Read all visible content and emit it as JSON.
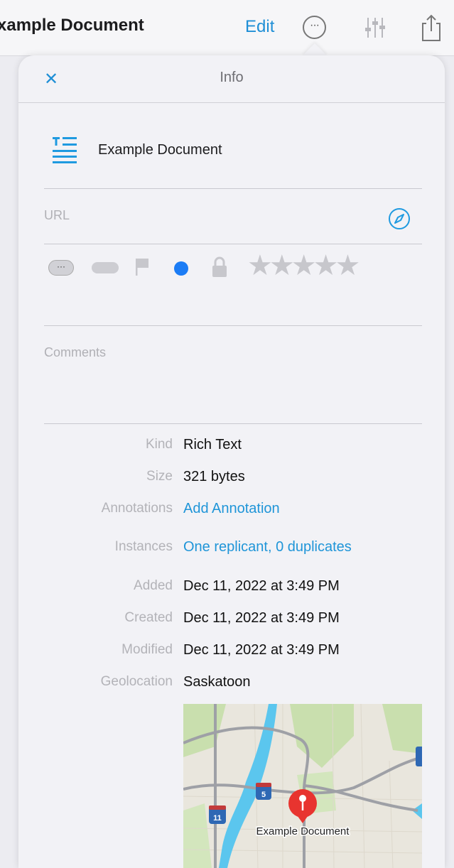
{
  "toolbar": {
    "title": "xample Document",
    "edit_label": "Edit",
    "more_label": "···"
  },
  "info": {
    "title": "Info",
    "close_label": "✕",
    "doc_name": "Example Document",
    "url_label": "URL",
    "tag_label": "···",
    "stars": "★★★★★",
    "rating": 0,
    "label_color": "#1b7cf5",
    "comments_placeholder": "Comments"
  },
  "meta": {
    "kind": {
      "label": "Kind",
      "value": "Rich Text"
    },
    "size": {
      "label": "Size",
      "value": "321 bytes"
    },
    "annotations": {
      "label": "Annotations",
      "value": "Add Annotation"
    },
    "instances": {
      "label": "Instances",
      "value": "One replicant, 0 duplicates"
    },
    "added": {
      "label": "Added",
      "value": "Dec 11, 2022 at 3:49 PM"
    },
    "created": {
      "label": "Created",
      "value": "Dec 11, 2022 at 3:49 PM"
    },
    "modified": {
      "label": "Modified",
      "value": "Dec 11, 2022 at 3:49 PM"
    },
    "geolocation": {
      "label": "Geolocation",
      "value": "Saskatoon"
    }
  },
  "map": {
    "pin_label": "Example Document",
    "shield_5": "5",
    "shield_11": "11"
  },
  "colors": {
    "accent": "#1f8fd6",
    "link": "#1f95d8",
    "pin": "#e8342f"
  }
}
